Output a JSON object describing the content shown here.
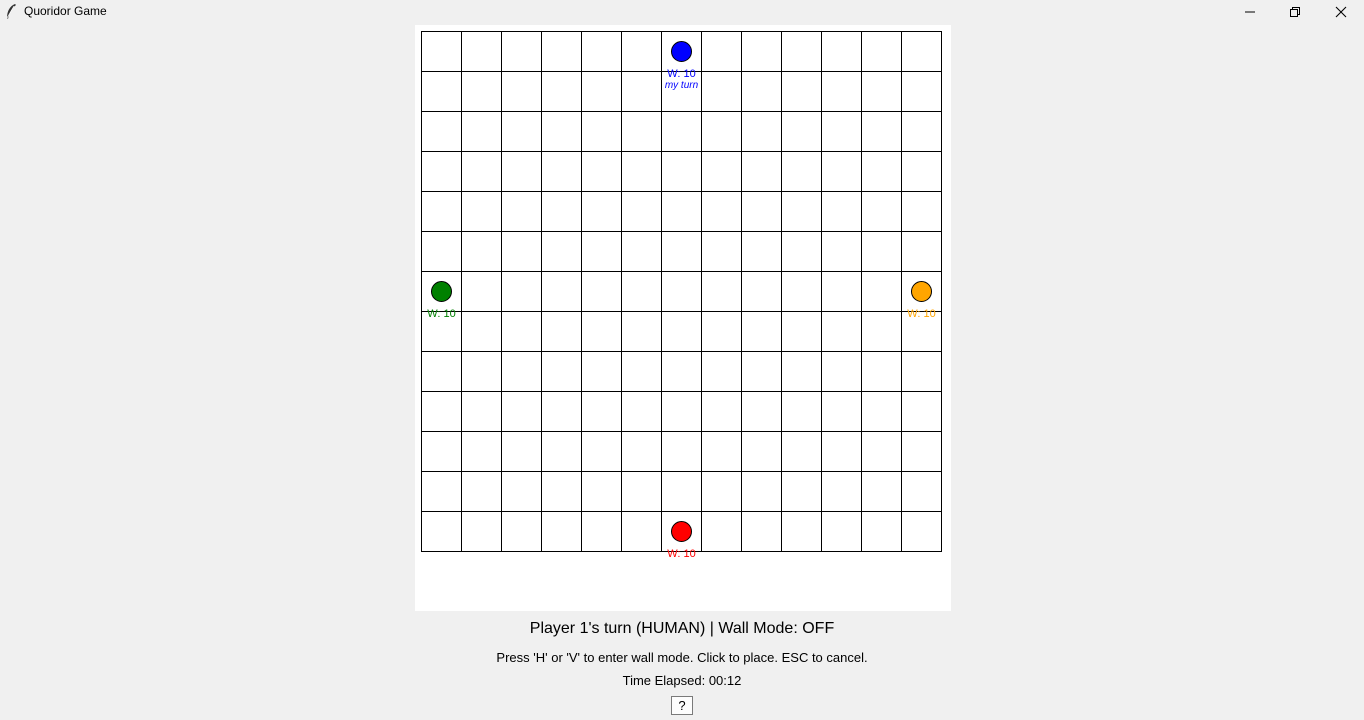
{
  "window": {
    "title": "Quoridor Game"
  },
  "board": {
    "size": 13,
    "grid_color": "#000000",
    "background": "#ffffff",
    "pawns": [
      {
        "id": "blue",
        "color": "#0000ff",
        "row": 0,
        "col": 6,
        "label": "W: 10",
        "turn_label": "my turn"
      },
      {
        "id": "green",
        "color": "#008000",
        "row": 6,
        "col": 0,
        "label": "W: 10",
        "turn_label": ""
      },
      {
        "id": "orange",
        "color": "#ffa500",
        "row": 6,
        "col": 12,
        "label": "W: 10",
        "turn_label": ""
      },
      {
        "id": "red",
        "color": "#ff0000",
        "row": 12,
        "col": 6,
        "label": "W: 10",
        "turn_label": ""
      }
    ]
  },
  "status": {
    "turn_text": "Player 1's turn (HUMAN) | Wall Mode: OFF",
    "help_text": "Press 'H' or 'V' to enter wall mode. Click to place. ESC to cancel.",
    "time_text": "Time Elapsed: 00:12"
  },
  "help_button": {
    "label": "?"
  }
}
